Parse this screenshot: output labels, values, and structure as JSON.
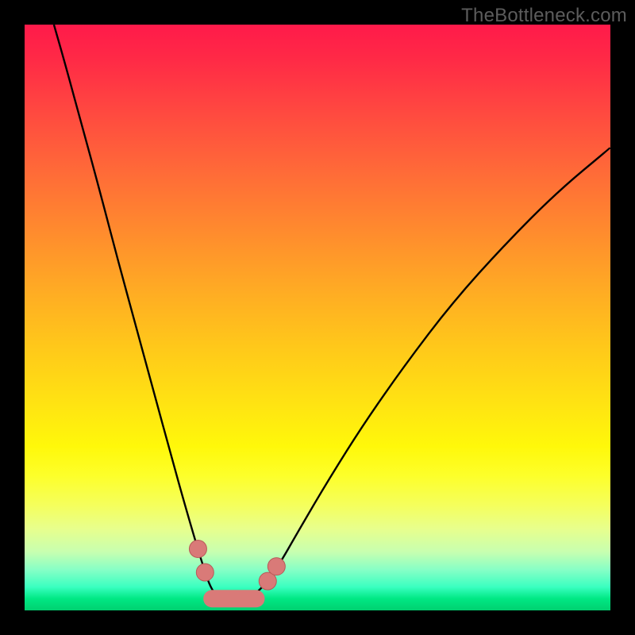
{
  "watermark": "TheBottleneck.com",
  "colors": {
    "frame": "#000000",
    "curve_stroke": "#000000",
    "curve_stroke_width": 2.4,
    "marker_fill": "#d97a78",
    "marker_stroke": "#b85a58",
    "marker_radius": 11,
    "flat_segment_stroke": "#d97a78",
    "flat_segment_width": 22
  },
  "chart_data": {
    "type": "line",
    "title": "",
    "xlabel": "",
    "ylabel": "",
    "xlim": [
      0,
      100
    ],
    "ylim": [
      0,
      100
    ],
    "grid": false,
    "legend": false,
    "curve": {
      "description": "V-shaped bottleneck curve (percentage bottleneck vs component balance). Minimum band at x≈32–39, y≈2.",
      "points": [
        {
          "x": 5.0,
          "y": 100.0
        },
        {
          "x": 7.0,
          "y": 93.0
        },
        {
          "x": 10.0,
          "y": 82.0
        },
        {
          "x": 13.0,
          "y": 71.0
        },
        {
          "x": 16.0,
          "y": 59.5
        },
        {
          "x": 19.0,
          "y": 48.5
        },
        {
          "x": 22.0,
          "y": 37.5
        },
        {
          "x": 25.0,
          "y": 26.5
        },
        {
          "x": 27.5,
          "y": 17.5
        },
        {
          "x": 30.0,
          "y": 9.0
        },
        {
          "x": 32.0,
          "y": 3.0
        },
        {
          "x": 34.0,
          "y": 2.0
        },
        {
          "x": 36.0,
          "y": 2.0
        },
        {
          "x": 38.0,
          "y": 2.2
        },
        {
          "x": 40.0,
          "y": 3.2
        },
        {
          "x": 43.0,
          "y": 7.0
        },
        {
          "x": 47.0,
          "y": 14.0
        },
        {
          "x": 52.0,
          "y": 22.5
        },
        {
          "x": 58.0,
          "y": 32.0
        },
        {
          "x": 65.0,
          "y": 42.0
        },
        {
          "x": 73.0,
          "y": 52.5
        },
        {
          "x": 82.0,
          "y": 62.5
        },
        {
          "x": 91.0,
          "y": 71.5
        },
        {
          "x": 100.0,
          "y": 79.0
        }
      ]
    },
    "markers": [
      {
        "x": 29.6,
        "y": 10.5
      },
      {
        "x": 30.8,
        "y": 6.5
      },
      {
        "x": 41.5,
        "y": 5.0
      },
      {
        "x": 43.0,
        "y": 7.5
      }
    ],
    "flat_segment": {
      "x1": 32.0,
      "x2": 39.5,
      "y": 2.0
    }
  }
}
